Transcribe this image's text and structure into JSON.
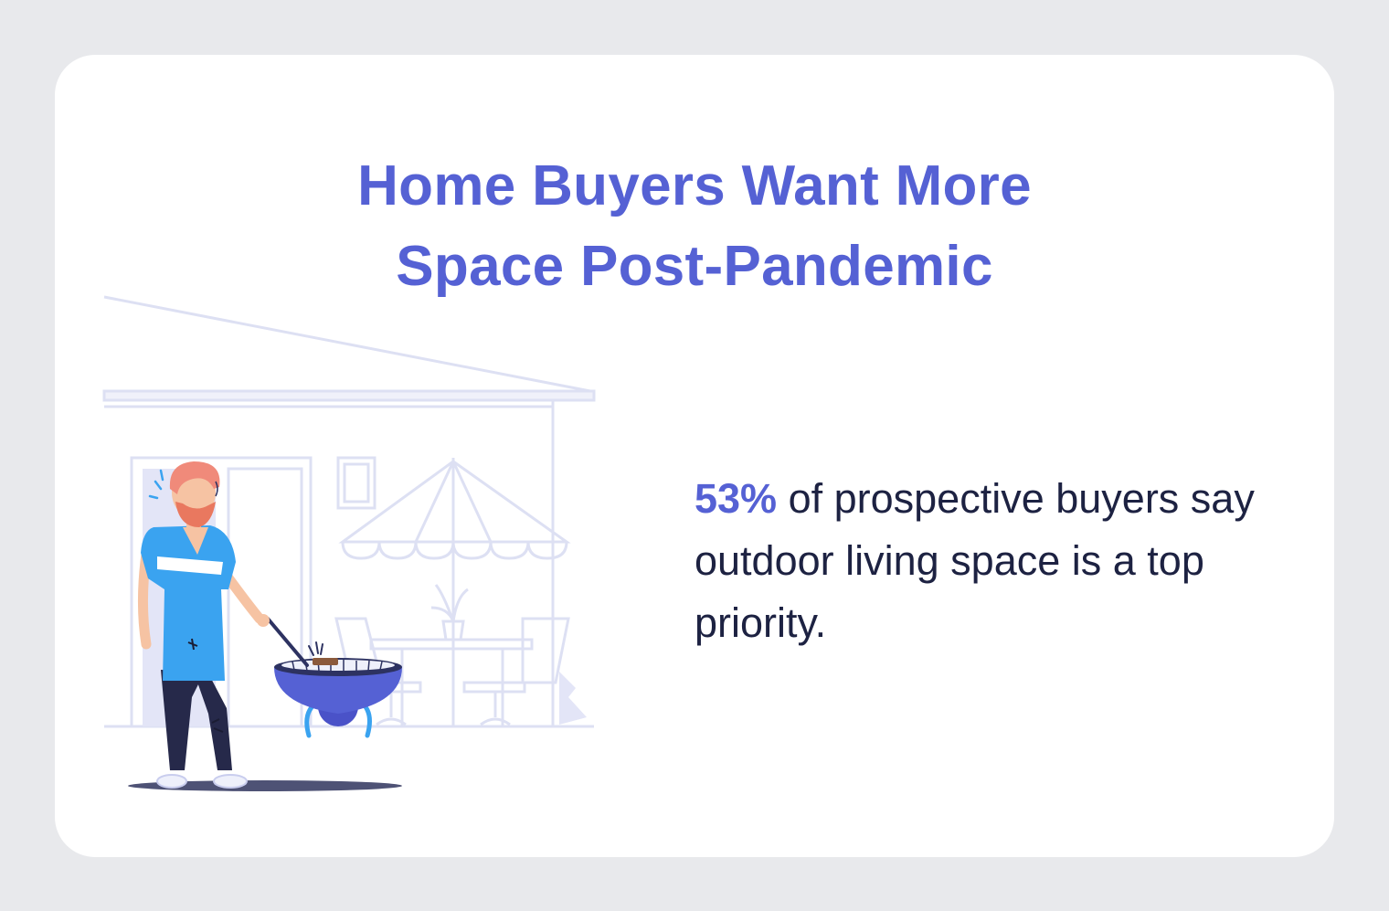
{
  "title": {
    "line1": "Home Buyers Want More",
    "line2": "Space Post-Pandemic"
  },
  "stat": {
    "highlight": "53%",
    "text": " of prospective buyers say outdoor living space is a top priority."
  },
  "illustration": {
    "icon": "backyard-grill-illustration",
    "colors": {
      "outline": "#dde0f3",
      "door_fill": "#e3e5f7",
      "shirt": "#3aa3f0",
      "grill": "#5561d4",
      "pants": "#26294a",
      "hair": "#f08a7a"
    }
  },
  "colors": {
    "accent": "#5561d4",
    "text": "#1d2242",
    "background": "#e8e9ec",
    "card": "#ffffff"
  }
}
